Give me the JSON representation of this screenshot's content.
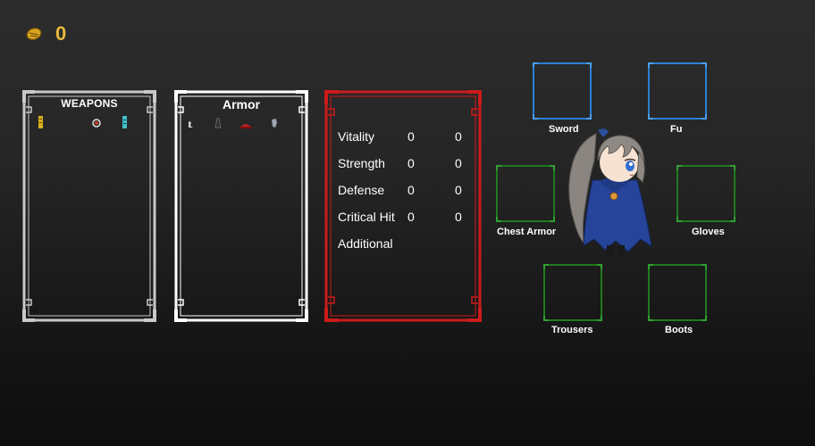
{
  "currency": {
    "icon": "coin-icon",
    "count": "0",
    "color": "#e7b83c"
  },
  "panels": {
    "weapons": {
      "title": "WEAPONS",
      "items": [
        "yellow-talisman-icon",
        "fire-staff-icon",
        "cyan-scroll-icon"
      ]
    },
    "armor": {
      "title": "Armor",
      "items": [
        "small-boot-icon",
        "dark-robe-icon",
        "red-hat-icon",
        "silver-glove-icon"
      ]
    }
  },
  "stats": {
    "rows": [
      {
        "label": "Vitality",
        "base": "0",
        "bonus": "0"
      },
      {
        "label": "Strength",
        "base": "0",
        "bonus": "0"
      },
      {
        "label": "Defense",
        "base": "0",
        "bonus": "0"
      },
      {
        "label": "Critical Hit",
        "base": "0",
        "bonus": "0"
      }
    ],
    "additional_label": "Additional"
  },
  "equipment": {
    "sword": "Sword",
    "fu": "Fu",
    "chest_armor": "Chest Armor",
    "gloves": "Gloves",
    "trousers": "Trousers",
    "boots": "Boots"
  },
  "colors": {
    "weapons_frame": "#c8c8c8",
    "armor_frame": "#ffffff",
    "stats_frame": "#cc1b1b",
    "weapon_slot": "#2a7fd4",
    "armor_slot": "#1f7a1f"
  }
}
